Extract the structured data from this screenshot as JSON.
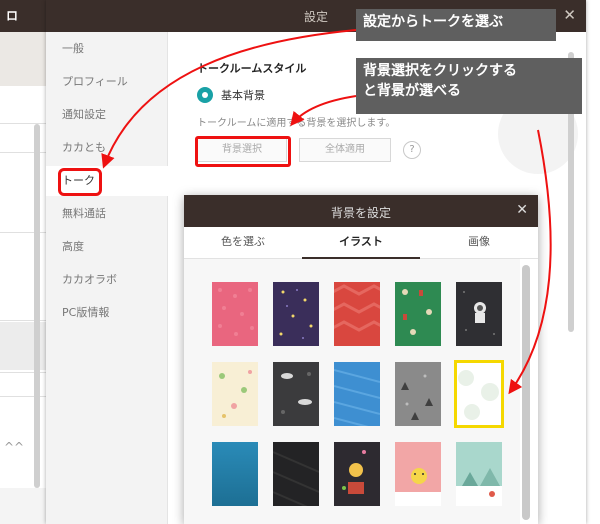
{
  "background_app": {
    "title_glyph": "ロ",
    "chevron": "^^"
  },
  "settings": {
    "title": "設定",
    "close": "✕",
    "menu_glyph": "≡",
    "nav": [
      {
        "label": "一般"
      },
      {
        "label": "プロフィール"
      },
      {
        "label": "通知設定"
      },
      {
        "label": "カカとも"
      },
      {
        "label": "トーク"
      },
      {
        "label": "無料通話"
      },
      {
        "label": "高度"
      },
      {
        "label": "カカオラボ"
      },
      {
        "label": "PC版情報"
      }
    ],
    "active_nav": "トーク",
    "section_title": "トークルームスタイル",
    "radio_label": "基本背景",
    "description": "トークルームに適用する背景を選択します。",
    "bg_select_button": "背景選択",
    "apply_all_button": "全体適用",
    "help": "?"
  },
  "dialog": {
    "title": "背景を設定",
    "close": "✕",
    "tabs": [
      {
        "label": "色を選ぶ"
      },
      {
        "label": "イラスト"
      },
      {
        "label": "画像"
      }
    ],
    "active_tab": "イラスト",
    "thumbnails": [
      {
        "name": "pink-pattern"
      },
      {
        "name": "purple-stars"
      },
      {
        "name": "red-stripes"
      },
      {
        "name": "green-figures"
      },
      {
        "name": "dark-astronaut"
      },
      {
        "name": "cream-trees"
      },
      {
        "name": "dark-clouds"
      },
      {
        "name": "blue-pattern"
      },
      {
        "name": "gray-trees"
      },
      {
        "name": "white-circles",
        "selected": true
      },
      {
        "name": "teal-gradient"
      },
      {
        "name": "black-pattern"
      },
      {
        "name": "dark-character"
      },
      {
        "name": "pink-character"
      },
      {
        "name": "mint-landscape"
      }
    ]
  },
  "callouts": {
    "c1": "設定からトークを選ぶ",
    "c2_line1": "背景選択をクリックする",
    "c2_line2": "と背景が選べる"
  },
  "colors": {
    "titlebar": "#3a2e2a",
    "radio_accent": "#19a1a6",
    "highlight_red": "#e11111",
    "selected_yellow": "#f5d800",
    "callout_bg": "#5f5f5f"
  }
}
